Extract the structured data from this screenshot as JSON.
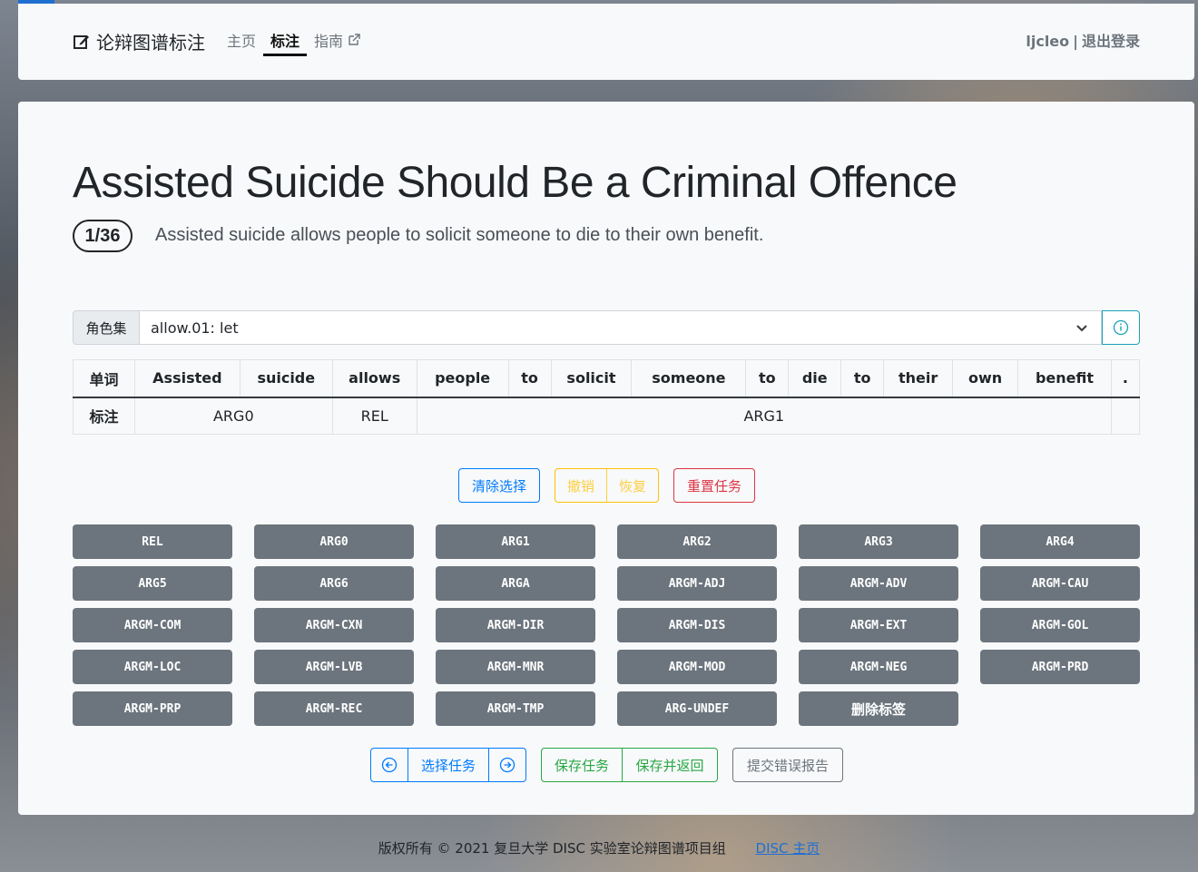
{
  "navbar": {
    "brand": "论辩图谱标注",
    "links": {
      "home": "主页",
      "annotate": "标注",
      "guide": "指南"
    },
    "user": "ljcleo",
    "logout": "退出登录"
  },
  "task": {
    "title": "Assisted Suicide Should Be a Criminal Offence",
    "counter": "1/36",
    "sentence": "Assisted suicide allows people to solicit someone to die to their own benefit."
  },
  "roleset": {
    "label": "角色集",
    "value": "allow.01: let"
  },
  "table": {
    "word_header": "单词",
    "label_header": "标注",
    "words": [
      "Assisted",
      "suicide",
      "allows",
      "people",
      "to",
      "solicit",
      "someone",
      "to",
      "die",
      "to",
      "their",
      "own",
      "benefit",
      "."
    ],
    "spans": [
      {
        "label": "ARG0",
        "span": 2
      },
      {
        "label": "REL",
        "span": 1
      },
      {
        "label": "ARG1",
        "span": 10
      },
      {
        "label": "",
        "span": 1
      }
    ]
  },
  "actions": {
    "clear": "清除选择",
    "undo": "撤销",
    "redo": "恢复",
    "reset": "重置任务"
  },
  "labels": [
    "REL",
    "ARG0",
    "ARG1",
    "ARG2",
    "ARG3",
    "ARG4",
    "ARG5",
    "ARG6",
    "ARGA",
    "ARGM-ADJ",
    "ARGM-ADV",
    "ARGM-CAU",
    "ARGM-COM",
    "ARGM-CXN",
    "ARGM-DIR",
    "ARGM-DIS",
    "ARGM-EXT",
    "ARGM-GOL",
    "ARGM-LOC",
    "ARGM-LVB",
    "ARGM-MNR",
    "ARGM-MOD",
    "ARGM-NEG",
    "ARGM-PRD",
    "ARGM-PRP",
    "ARGM-REC",
    "ARGM-TMP",
    "ARG-UNDEF",
    "删除标签"
  ],
  "bottom": {
    "select_task": "选择任务",
    "save": "保存任务",
    "save_return": "保存并返回",
    "report": "提交错误报告"
  },
  "footer": {
    "copyright": "版权所有 © 2021 复旦大学 DISC 实验室论辩图谱项目组",
    "link": "DISC 主页"
  },
  "colors": {
    "primary": "#007bff",
    "warning": "#ffc107",
    "danger": "#dc3545",
    "success": "#28a745",
    "secondary": "#6c757d"
  }
}
